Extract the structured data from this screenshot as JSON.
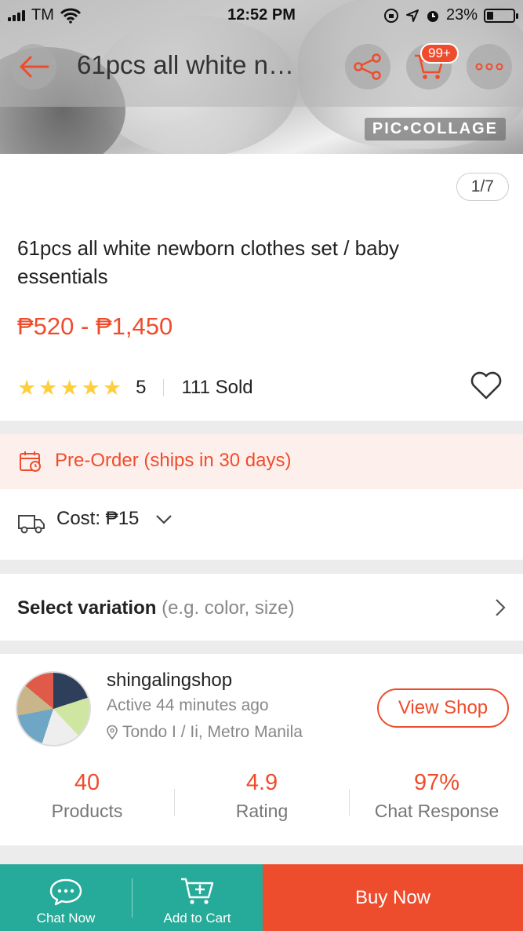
{
  "status_bar": {
    "carrier": "TM",
    "time": "12:52 PM",
    "battery": "23%"
  },
  "header": {
    "title": "61pcs all white n…",
    "cart_badge": "99+"
  },
  "gallery": {
    "watermark": "PIC•COLLAGE",
    "pager": "1/7"
  },
  "product": {
    "title": "61pcs all white newborn clothes set / baby essentials",
    "price": "₱520 - ₱1,450",
    "rating": "5",
    "sold": "111 Sold",
    "star_count": 5
  },
  "preorder": {
    "label": "Pre-Order (ships in 30 days)"
  },
  "shipping": {
    "cost_label": "Cost: ₱15"
  },
  "variation": {
    "label": "Select variation",
    "hint": "(e.g. color, size)"
  },
  "shop": {
    "name": "shingalingshop",
    "active": "Active 44 minutes ago",
    "location": "Tondo I / Ii, Metro Manila",
    "view_shop": "View Shop",
    "stats": [
      {
        "value": "40",
        "label": "Products"
      },
      {
        "value": "4.9",
        "label": "Rating"
      },
      {
        "value": "97%",
        "label": "Chat Response"
      }
    ]
  },
  "bottom_bar": {
    "chat_now": "Chat Now",
    "add_to_cart": "Add to Cart",
    "buy_now": "Buy Now"
  },
  "colors": {
    "accent": "#ee4d2d",
    "teal": "#26aa99",
    "star": "#ffce3d"
  },
  "icons": [
    "back-arrow-icon",
    "share-icon",
    "cart-icon",
    "more-icon",
    "heart-icon",
    "calendar-icon",
    "truck-icon",
    "chevron-down-icon",
    "chevron-right-icon",
    "location-pin-icon",
    "chat-icon",
    "add-cart-icon"
  ]
}
